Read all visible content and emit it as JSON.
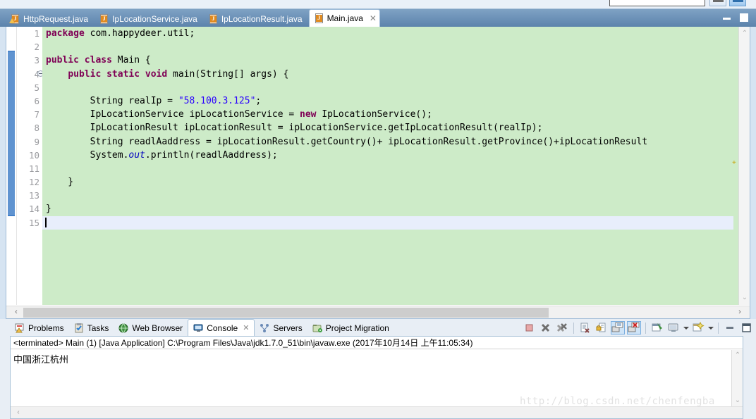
{
  "window": {
    "minimize_label": "Minimize",
    "maximize_label": "Restore"
  },
  "editor_tabs": [
    {
      "label": "HttpRequest.java",
      "icon": "java-file-warning-icon",
      "active": false,
      "closable": false
    },
    {
      "label": "IpLocationService.java",
      "icon": "java-file-icon",
      "active": false,
      "closable": false
    },
    {
      "label": "IpLocationResult.java",
      "icon": "java-file-icon",
      "active": false,
      "closable": false
    },
    {
      "label": "Main.java",
      "icon": "java-file-icon",
      "active": true,
      "closable": true,
      "close_glyph": "✕"
    }
  ],
  "editor": {
    "line_numbers": [
      "1",
      "2",
      "3",
      "4",
      "5",
      "6",
      "7",
      "8",
      "9",
      "10",
      "11",
      "12",
      "13",
      "14",
      "15"
    ],
    "fold_marker_line": 4,
    "current_line": 15,
    "change_bar_from_line": 3,
    "change_bar_to_line": 14,
    "lines": [
      "package com.happydeer.util;",
      "",
      "public class Main {",
      "    public static void main(String[] args) {",
      "",
      "        String realIp = \"58.100.3.125\";",
      "        IpLocationService ipLocationService = new IpLocationService();",
      "        IpLocationResult ipLocationResult = ipLocationService.getIpLocationResult(realIp);",
      "        String readlAaddress = ipLocationResult.getCountry()+ ipLocationResult.getProvince()+ipLocationResult",
      "        System.out.println(readlAaddress);",
      "",
      "    }",
      "",
      "}",
      ""
    ],
    "colors": {
      "background": "#cdebc8",
      "keyword": "#7f0055",
      "string": "#2a00ff",
      "field": "#0000c0",
      "current_line_highlight": "#e8eefb",
      "line_number": "#999a9e",
      "change_bar": "#2a6fc0"
    },
    "scroll": {
      "up_arrow": "⌃",
      "down_arrow": "⌄",
      "left_arrow": "‹",
      "right_arrow": "›"
    }
  },
  "console_tabs": [
    {
      "label": "Problems",
      "icon": "problems-icon",
      "active": false,
      "closable": false
    },
    {
      "label": "Tasks",
      "icon": "tasks-icon",
      "active": false,
      "closable": false
    },
    {
      "label": "Web Browser",
      "icon": "web-browser-icon",
      "active": false,
      "closable": false
    },
    {
      "label": "Console",
      "icon": "console-icon",
      "active": true,
      "closable": true,
      "close_glyph": "✕"
    },
    {
      "label": "Servers",
      "icon": "servers-icon",
      "active": false,
      "closable": false
    },
    {
      "label": "Project Migration",
      "icon": "project-migration-icon",
      "active": false,
      "closable": false
    }
  ],
  "console_toolbar": [
    {
      "name": "terminate-button",
      "icon": "stop-square-icon"
    },
    {
      "name": "remove-launch-button",
      "icon": "remove-x-icon"
    },
    {
      "name": "remove-all-terminated-button",
      "icon": "remove-all-x-icon"
    },
    {
      "name": "clear-console-button",
      "icon": "clear-console-icon"
    },
    {
      "name": "scroll-lock-button",
      "icon": "lock-scroll-icon"
    },
    {
      "name": "show-console-on-output-button",
      "icon": "console-stdout-icon"
    },
    {
      "name": "show-console-on-error-button",
      "icon": "console-stderr-icon"
    },
    {
      "name": "pin-console-button",
      "icon": "pin-console-icon"
    },
    {
      "name": "display-selected-console-button",
      "icon": "display-console-icon"
    },
    {
      "name": "display-selected-console-menu",
      "icon": "chevron-down-icon"
    },
    {
      "name": "open-console-button",
      "icon": "new-console-icon"
    },
    {
      "name": "open-console-menu",
      "icon": "chevron-down-icon"
    },
    {
      "name": "minimize-panel-button",
      "icon": "minimize-icon"
    },
    {
      "name": "maximize-panel-button",
      "icon": "maximize-icon"
    }
  ],
  "console": {
    "header": "<terminated> Main (1) [Java Application] C:\\Program Files\\Java\\jdk1.7.0_51\\bin\\javaw.exe (2017年10月14日 上午11:05:34)",
    "output": "中国浙江杭州",
    "scroll": {
      "up_arrow": "⌃",
      "down_arrow": "⌄",
      "left_arrow": "‹"
    }
  },
  "watermark": "http://blog.csdn.net/chenfengba",
  "top_strip": {
    "search_value": "",
    "search_placeholder": ""
  }
}
